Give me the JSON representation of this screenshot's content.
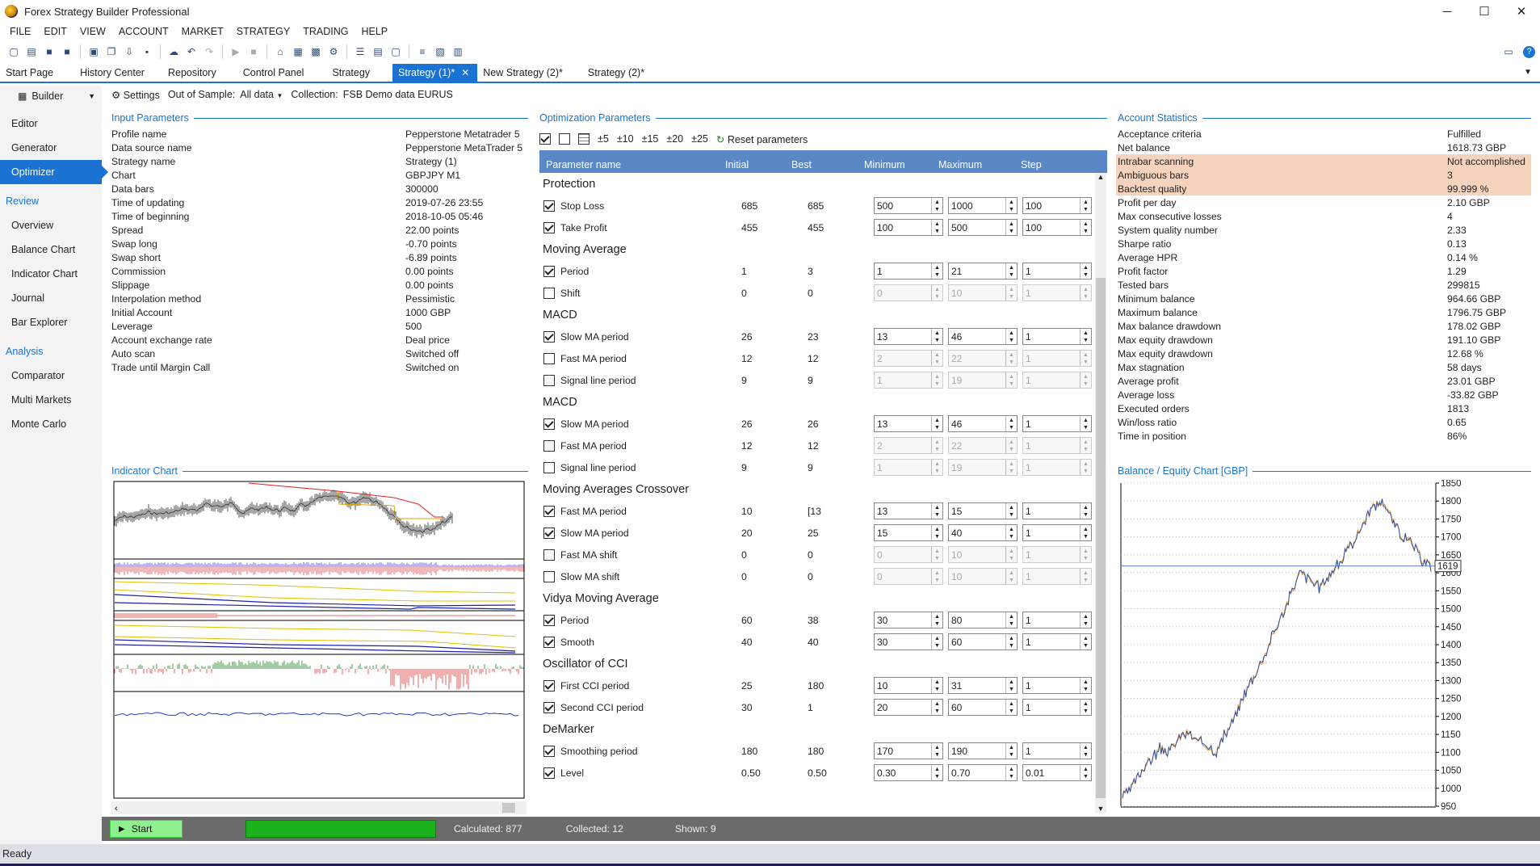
{
  "window": {
    "title": "Forex Strategy Builder Professional",
    "minimize": "─",
    "maximize": "☐",
    "close": "✕"
  },
  "menu": [
    "FILE",
    "EDIT",
    "VIEW",
    "ACCOUNT",
    "MARKET",
    "STRATEGY",
    "TRADING",
    "HELP"
  ],
  "tabs": [
    {
      "label": "Start Page"
    },
    {
      "label": "History Center"
    },
    {
      "label": "Repository"
    },
    {
      "label": "Control Panel"
    },
    {
      "label": "Strategy"
    },
    {
      "label": "Strategy (1)*",
      "active": true,
      "close": "✕"
    },
    {
      "label": "New Strategy (2)*"
    },
    {
      "label": "Strategy (2)*"
    }
  ],
  "sidebar": {
    "builder": "Builder",
    "items1": [
      "Editor",
      "Generator",
      "Optimizer"
    ],
    "active": "Optimizer",
    "review_head": "Review",
    "review": [
      "Overview",
      "Balance Chart",
      "Indicator Chart",
      "Journal",
      "Bar Explorer"
    ],
    "analysis_head": "Analysis",
    "analysis": [
      "Comparator",
      "Multi Markets",
      "Monte Carlo"
    ]
  },
  "settings": {
    "label": "Settings",
    "oos_label": "Out of Sample:",
    "oos_value": "All data",
    "collection_label": "Collection:",
    "collection_value": "FSB Demo data EURUS"
  },
  "input_params": {
    "title": "Input Parameters",
    "rows": [
      [
        "Profile name",
        "Pepperstone Metatrader 5"
      ],
      [
        "Data source name",
        "Pepperstone MetaTrader 5"
      ],
      [
        "Strategy name",
        "Strategy (1)"
      ],
      [
        "Chart",
        "GBPJPY M1"
      ],
      [
        "Data bars",
        "300000"
      ],
      [
        "Time of updating",
        "2019-07-26 23:55"
      ],
      [
        "Time of beginning",
        "2018-10-05 05:46"
      ],
      [
        "Spread",
        "22.00 points"
      ],
      [
        "Swap long",
        "-0.70 points"
      ],
      [
        "Swap short",
        "-6.89 points"
      ],
      [
        "Commission",
        "0.00 points"
      ],
      [
        "Slippage",
        "0.00 points"
      ],
      [
        "Interpolation method",
        "Pessimistic"
      ],
      [
        "Initial Account",
        "1000 GBP"
      ],
      [
        "Leverage",
        "500"
      ],
      [
        "Account exchange rate",
        "Deal price"
      ],
      [
        "Auto scan",
        "Switched off"
      ],
      [
        "Trade until Margin Call",
        "Switched on"
      ]
    ]
  },
  "optimization": {
    "title": "Optimization Parameters",
    "steps": [
      "±5",
      "±10",
      "±15",
      "±20",
      "±25"
    ],
    "reset": "Reset parameters",
    "headers": [
      "Parameter name",
      "Initial",
      "Best",
      "Minimum",
      "Maximum",
      "Step"
    ],
    "groups": [
      {
        "name": "Protection",
        "params": [
          {
            "name": "Stop Loss",
            "on": true,
            "initial": "685",
            "best": "685",
            "min": "500",
            "max": "1000",
            "step": "100"
          },
          {
            "name": "Take Profit",
            "on": true,
            "initial": "455",
            "best": "455",
            "min": "100",
            "max": "500",
            "step": "100"
          }
        ]
      },
      {
        "name": "Moving Average",
        "params": [
          {
            "name": "Period",
            "on": true,
            "initial": "1",
            "best": "3",
            "min": "1",
            "max": "21",
            "step": "1"
          },
          {
            "name": "Shift",
            "on": false,
            "initial": "0",
            "best": "0",
            "min": "0",
            "max": "10",
            "step": "1"
          }
        ]
      },
      {
        "name": "MACD",
        "params": [
          {
            "name": "Slow MA period",
            "on": true,
            "initial": "26",
            "best": "23",
            "min": "13",
            "max": "46",
            "step": "1"
          },
          {
            "name": "Fast MA period",
            "on": false,
            "initial": "12",
            "best": "12",
            "min": "2",
            "max": "22",
            "step": "1"
          },
          {
            "name": "Signal line period",
            "on": false,
            "initial": "9",
            "best": "9",
            "min": "1",
            "max": "19",
            "step": "1"
          }
        ]
      },
      {
        "name": "MACD",
        "params": [
          {
            "name": "Slow MA period",
            "on": true,
            "initial": "26",
            "best": "26",
            "min": "13",
            "max": "46",
            "step": "1"
          },
          {
            "name": "Fast MA period",
            "on": false,
            "initial": "12",
            "best": "12",
            "min": "2",
            "max": "22",
            "step": "1"
          },
          {
            "name": "Signal line period",
            "on": false,
            "initial": "9",
            "best": "9",
            "min": "1",
            "max": "19",
            "step": "1"
          }
        ]
      },
      {
        "name": "Moving Averages Crossover",
        "params": [
          {
            "name": "Fast MA period",
            "on": true,
            "initial": "10",
            "best": "[13",
            "min": "13",
            "max": "15",
            "step": "1"
          },
          {
            "name": "Slow MA period",
            "on": true,
            "initial": "20",
            "best": "25",
            "min": "15",
            "max": "40",
            "step": "1"
          },
          {
            "name": "Fast MA shift",
            "on": false,
            "initial": "0",
            "best": "0",
            "min": "0",
            "max": "10",
            "step": "1"
          },
          {
            "name": "Slow MA shift",
            "on": false,
            "initial": "0",
            "best": "0",
            "min": "0",
            "max": "10",
            "step": "1"
          }
        ]
      },
      {
        "name": "Vidya Moving Average",
        "params": [
          {
            "name": "Period",
            "on": true,
            "initial": "60",
            "best": "38",
            "min": "30",
            "max": "80",
            "step": "1"
          },
          {
            "name": "Smooth",
            "on": true,
            "initial": "40",
            "best": "40",
            "min": "30",
            "max": "60",
            "step": "1"
          }
        ]
      },
      {
        "name": "Oscillator of CCI",
        "params": [
          {
            "name": "First CCI period",
            "on": true,
            "initial": "25",
            "best": "180",
            "min": "10",
            "max": "31",
            "step": "1"
          },
          {
            "name": "Second CCI period",
            "on": true,
            "initial": "30",
            "best": "1",
            "min": "20",
            "max": "60",
            "step": "1"
          }
        ]
      },
      {
        "name": "DeMarker",
        "params": [
          {
            "name": "Smoothing period",
            "on": true,
            "initial": "180",
            "best": "180",
            "min": "170",
            "max": "190",
            "step": "1"
          },
          {
            "name": "Level",
            "on": true,
            "initial": "0.50",
            "best": "0.50",
            "min": "0.30",
            "max": "0.70",
            "step": "0.01"
          }
        ]
      }
    ]
  },
  "account_stats": {
    "title": "Account Statistics",
    "rows": [
      [
        "Acceptance criteria",
        "Fulfilled",
        false
      ],
      [
        "Net balance",
        "1618.73 GBP",
        false
      ],
      [
        "Intrabar scanning",
        "Not accomplished",
        true
      ],
      [
        "Ambiguous bars",
        "3",
        true
      ],
      [
        "Backtest quality",
        "99.999 %",
        true
      ],
      [
        "Profit per day",
        "2.10 GBP",
        false
      ],
      [
        "Max consecutive losses",
        "4",
        false
      ],
      [
        "System quality number",
        "2.33",
        false
      ],
      [
        "Sharpe ratio",
        "0.13",
        false
      ],
      [
        "Average HPR",
        "0.14 %",
        false
      ],
      [
        "Profit factor",
        "1.29",
        false
      ],
      [
        "Tested bars",
        "299815",
        false
      ],
      [
        "Minimum balance",
        "964.66 GBP",
        false
      ],
      [
        "Maximum balance",
        "1796.75 GBP",
        false
      ],
      [
        "Max balance drawdown",
        "178.02 GBP",
        false
      ],
      [
        "Max equity drawdown",
        "191.10 GBP",
        false
      ],
      [
        "Max equity drawdown",
        "12.68 %",
        false
      ],
      [
        "Max stagnation",
        "58 days",
        false
      ],
      [
        "Average profit",
        "23.01 GBP",
        false
      ],
      [
        "Average loss",
        "-33.82 GBP",
        false
      ],
      [
        "Executed orders",
        "1813",
        false
      ],
      [
        "Win/loss ratio",
        "0.65",
        false
      ],
      [
        "Time in position",
        "86%",
        false
      ]
    ]
  },
  "indicator_chart": {
    "title": "Indicator Chart"
  },
  "balance_chart": {
    "title": "Balance / Equity Chart [GBP]",
    "current_label": "1619"
  },
  "chart_data": {
    "type": "line",
    "title": "Balance / Equity Chart [GBP]",
    "ylim": [
      950,
      1850
    ],
    "yticks": [
      1850,
      1800,
      1750,
      1700,
      1650,
      1600,
      1550,
      1500,
      1450,
      1400,
      1350,
      1300,
      1250,
      1200,
      1150,
      1100,
      1050,
      1000,
      950
    ],
    "current": 1619,
    "series": [
      {
        "values": [
          975,
          1000,
          1050,
          1080,
          1110,
          1100,
          1140,
          1155,
          1130,
          1120,
          1100,
          1150,
          1200,
          1260,
          1310,
          1360,
          1420,
          1480,
          1540,
          1600,
          1580,
          1560,
          1590,
          1620,
          1660,
          1700,
          1750,
          1790,
          1800,
          1740,
          1700,
          1680,
          1640,
          1619
        ]
      }
    ]
  },
  "bottom": {
    "start": "Start",
    "calculated": "Calculated: 877",
    "collected": "Collected: 12",
    "shown": "Shown: 9"
  },
  "status": "Ready",
  "colors": {
    "accent": "#1a73d2",
    "header": "#5b87c7",
    "highlight": "#f5d3bd",
    "progress": "#1bb31b"
  }
}
